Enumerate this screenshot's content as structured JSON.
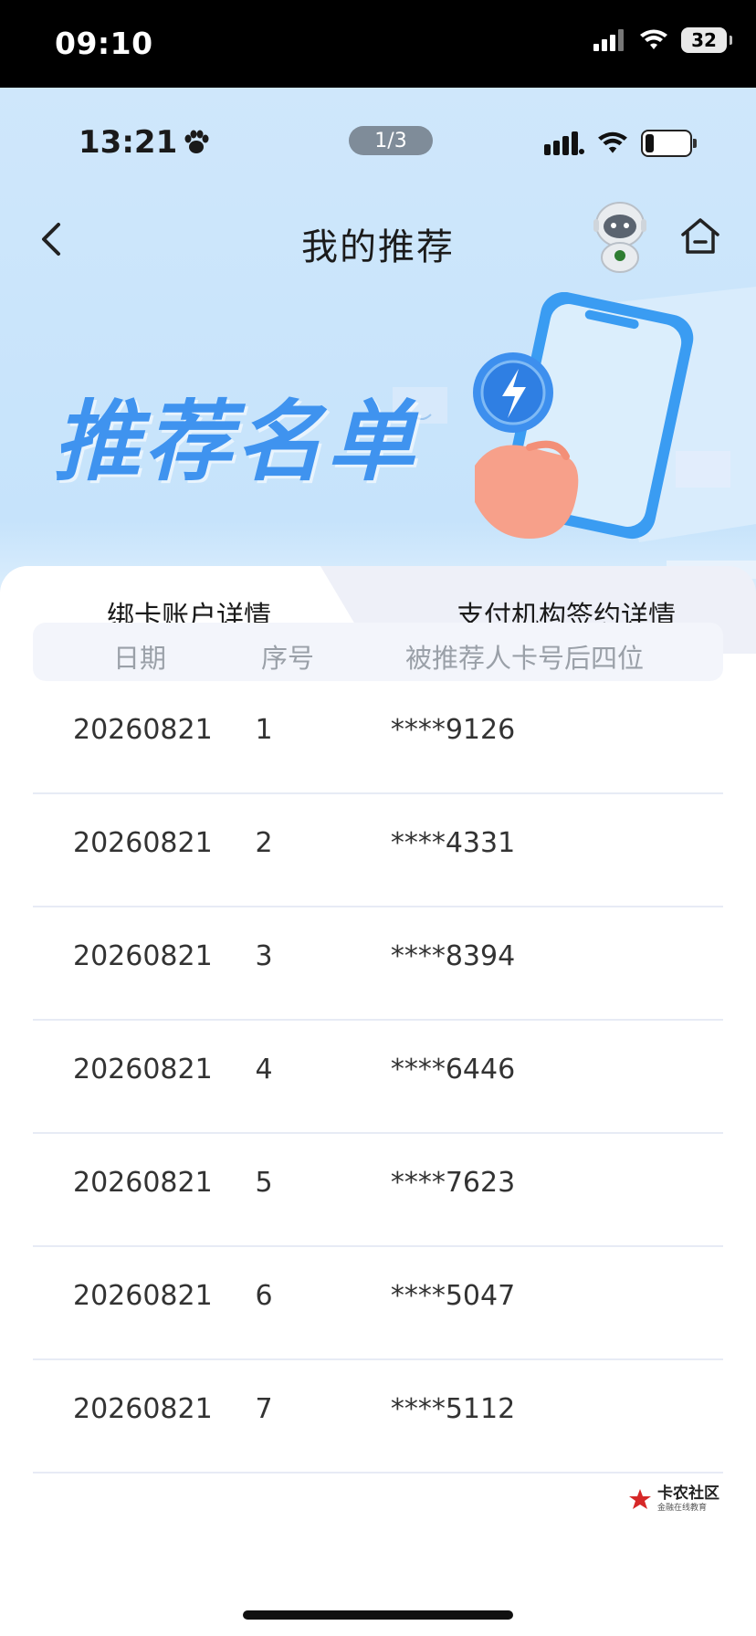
{
  "device_status": {
    "time": "09:10",
    "battery": "32"
  },
  "app_status": {
    "time": "13:21",
    "page_indicator": "1/3"
  },
  "nav": {
    "title": "我的推荐"
  },
  "banner": {
    "title": "推荐名单"
  },
  "tabs": [
    {
      "label": "绑卡账户详情",
      "active": true
    },
    {
      "label": "支付机构签约详情",
      "active": false
    }
  ],
  "table": {
    "headers": [
      "日期",
      "序号",
      "被推荐人卡号后四位"
    ],
    "rows": [
      [
        "20260821",
        "1",
        "****9126"
      ],
      [
        "20260821",
        "2",
        "****4331"
      ],
      [
        "20260821",
        "3",
        "****8394"
      ],
      [
        "20260821",
        "4",
        "****6446"
      ],
      [
        "20260821",
        "5",
        "****7623"
      ],
      [
        "20260821",
        "6",
        "****5047"
      ],
      [
        "20260821",
        "7",
        "****5112"
      ]
    ]
  },
  "watermark": {
    "main": "卡农社区",
    "sub": "金融在线教育"
  },
  "colors": {
    "accent": "#3f93ef",
    "banner_bg": "#cfe7fb",
    "header_bg": "#f3f5fb"
  }
}
